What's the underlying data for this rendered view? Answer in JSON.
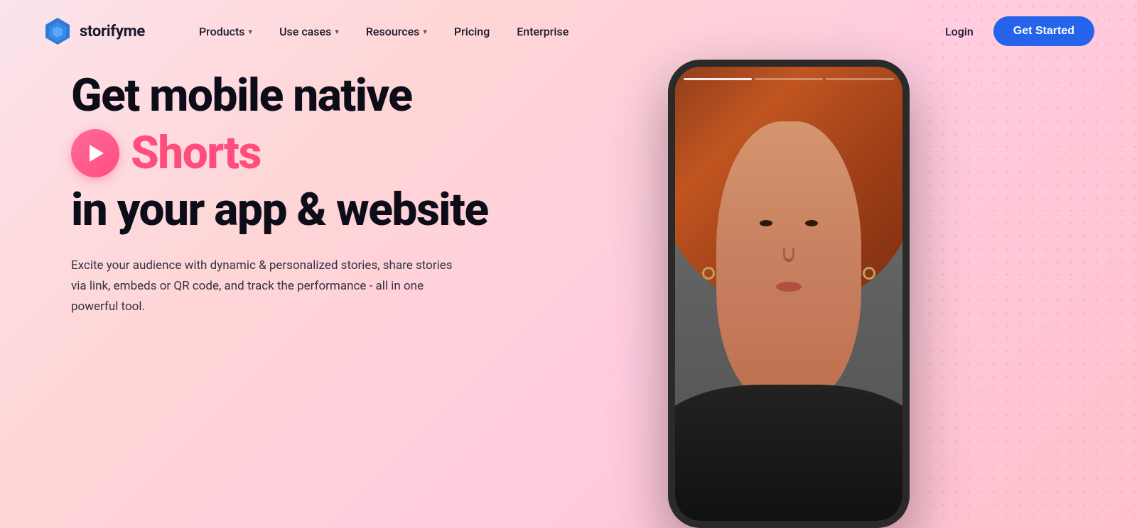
{
  "brand": {
    "name": "storifyme",
    "logo_alt": "Storifyme Logo"
  },
  "nav": {
    "products_label": "Products",
    "use_cases_label": "Use cases",
    "resources_label": "Resources",
    "pricing_label": "Pricing",
    "enterprise_label": "Enterprise",
    "login_label": "Login",
    "get_started_label": "Get Started"
  },
  "hero": {
    "title_line1": "Get mobile native",
    "title_shorts": "Shorts",
    "title_line3": "in your app & website",
    "description": "Excite your audience with dynamic & personalized stories, share stories via link, embeds or QR code, and track the performance - all in one powerful tool.",
    "cta_label": "Get Started"
  },
  "colors": {
    "accent_blue": "#2563eb",
    "accent_pink": "#ff4d7d",
    "text_dark": "#0d0d1a"
  }
}
